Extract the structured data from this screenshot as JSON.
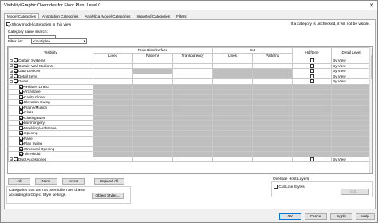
{
  "window": {
    "title": "Visibility/Graphic Overrides for Floor Plan: Level 0",
    "close_glyph": "✕"
  },
  "tabs": [
    {
      "label": "Model Categories",
      "active": true
    },
    {
      "label": "Annotation Categories",
      "active": false
    },
    {
      "label": "Analytical Model Categories",
      "active": false
    },
    {
      "label": "Imported Categories",
      "active": false
    },
    {
      "label": "Filters",
      "active": false
    }
  ],
  "show_model": {
    "label": "Show model categories in this view",
    "checked": true
  },
  "unchecked_note": "If a category is unchecked, it will not be visible.",
  "search": {
    "label": "Category name search:",
    "value": ""
  },
  "filter": {
    "label": "Filter list:",
    "value": "<multiple>"
  },
  "table": {
    "group_headers": {
      "visibility": "Visibility",
      "projection": "Projection/Surface",
      "cut": "Cut",
      "halftone": "Halftone",
      "detail": "Detail Level"
    },
    "sub_headers": {
      "lines": "Lines",
      "patterns": "Patterns",
      "transparency": "Transparency",
      "cut_lines": "Lines",
      "cut_patterns": "Patterns"
    },
    "rows": [
      {
        "name": "Curtain Systems",
        "level": 0,
        "expander": "+",
        "checked": true,
        "gray_proj": false,
        "gray_cut": false,
        "halftone": true,
        "detail": "By View"
      },
      {
        "name": "Curtain Wall Mullions",
        "level": 0,
        "expander": "+",
        "checked": true,
        "gray_proj": false,
        "gray_cut": false,
        "halftone": true,
        "detail": "By View"
      },
      {
        "name": "Data Devices",
        "level": 0,
        "expander": "+",
        "checked": true,
        "gray_proj": false,
        "gray_cut": true,
        "gray_pattern": true,
        "halftone": true,
        "detail": "By View"
      },
      {
        "name": "Detail Items",
        "level": 0,
        "expander": "+",
        "checked": true,
        "gray_proj": false,
        "gray_cut": true,
        "halftone": true,
        "detail": "By View"
      },
      {
        "name": "Doors",
        "level": 0,
        "expander": "−",
        "checked": true,
        "gray_proj": false,
        "gray_cut": false,
        "halftone": true,
        "detail": "By View"
      },
      {
        "name": "<Hidden Lines>",
        "level": 1,
        "checked": true,
        "gray_proj": true,
        "gray_cut": true,
        "halftone": false,
        "detail": ""
      },
      {
        "name": "Architrave",
        "level": 1,
        "checked": true,
        "gray_proj": true,
        "gray_cut": true,
        "halftone": false,
        "detail": ""
      },
      {
        "name": "Cavity Closer",
        "level": 1,
        "checked": true,
        "gray_proj": true,
        "gray_cut": true,
        "halftone": false,
        "detail": ""
      },
      {
        "name": "Elevation Swing",
        "level": 1,
        "checked": true,
        "gray_proj": true,
        "gray_cut": true,
        "halftone": false,
        "detail": ""
      },
      {
        "name": "Frame/Mullion",
        "level": 1,
        "checked": true,
        "gray_proj": true,
        "gray_cut": true,
        "halftone": false,
        "detail": ""
      },
      {
        "name": "Glass",
        "level": 1,
        "checked": true,
        "gray_proj": true,
        "gray_cut": true,
        "halftone": false,
        "detail": ""
      },
      {
        "name": "Glazing Bars",
        "level": 1,
        "checked": true,
        "gray_proj": true,
        "gray_cut": true,
        "halftone": false,
        "detail": ""
      },
      {
        "name": "Ironmongery",
        "level": 1,
        "checked": true,
        "gray_proj": true,
        "gray_cut": true,
        "halftone": false,
        "detail": ""
      },
      {
        "name": "Moulding/Architrave",
        "level": 1,
        "checked": true,
        "gray_proj": true,
        "gray_cut": true,
        "halftone": false,
        "detail": ""
      },
      {
        "name": "Opening",
        "level": 1,
        "checked": true,
        "gray_proj": true,
        "gray_cut": true,
        "halftone": false,
        "detail": ""
      },
      {
        "name": "Panel",
        "level": 1,
        "checked": true,
        "gray_proj": true,
        "gray_cut": true,
        "halftone": false,
        "detail": ""
      },
      {
        "name": "Plan Swing",
        "level": 1,
        "checked": true,
        "gray_proj": true,
        "gray_cut": true,
        "halftone": false,
        "detail": ""
      },
      {
        "name": "Structural Opening",
        "level": 1,
        "checked": true,
        "gray_proj": true,
        "gray_cut": true,
        "halftone": false,
        "detail": ""
      },
      {
        "name": "Threshold",
        "level": 1,
        "checked": true,
        "gray_proj": true,
        "gray_cut": true,
        "halftone": false,
        "detail": ""
      },
      {
        "name": "Duct Accessories",
        "level": 0,
        "expander": "+",
        "checked": true,
        "gray_proj": false,
        "gray_cut": false,
        "halftone": true,
        "detail": "By View"
      }
    ]
  },
  "buttons": {
    "all": "All",
    "none": "None",
    "invert": "Invert",
    "expand_all": "Expand All",
    "object_styles": "Object Styles...",
    "edit": "Edit...",
    "ok": "OK",
    "cancel": "Cancel",
    "apply": "Apply",
    "help": "Help"
  },
  "info_note": "Categories that are not overridden are drawn according to Object Style settings.",
  "override_host": {
    "title": "Override Host Layers",
    "cut_line_styles": "Cut Line Styles",
    "checked": false
  }
}
